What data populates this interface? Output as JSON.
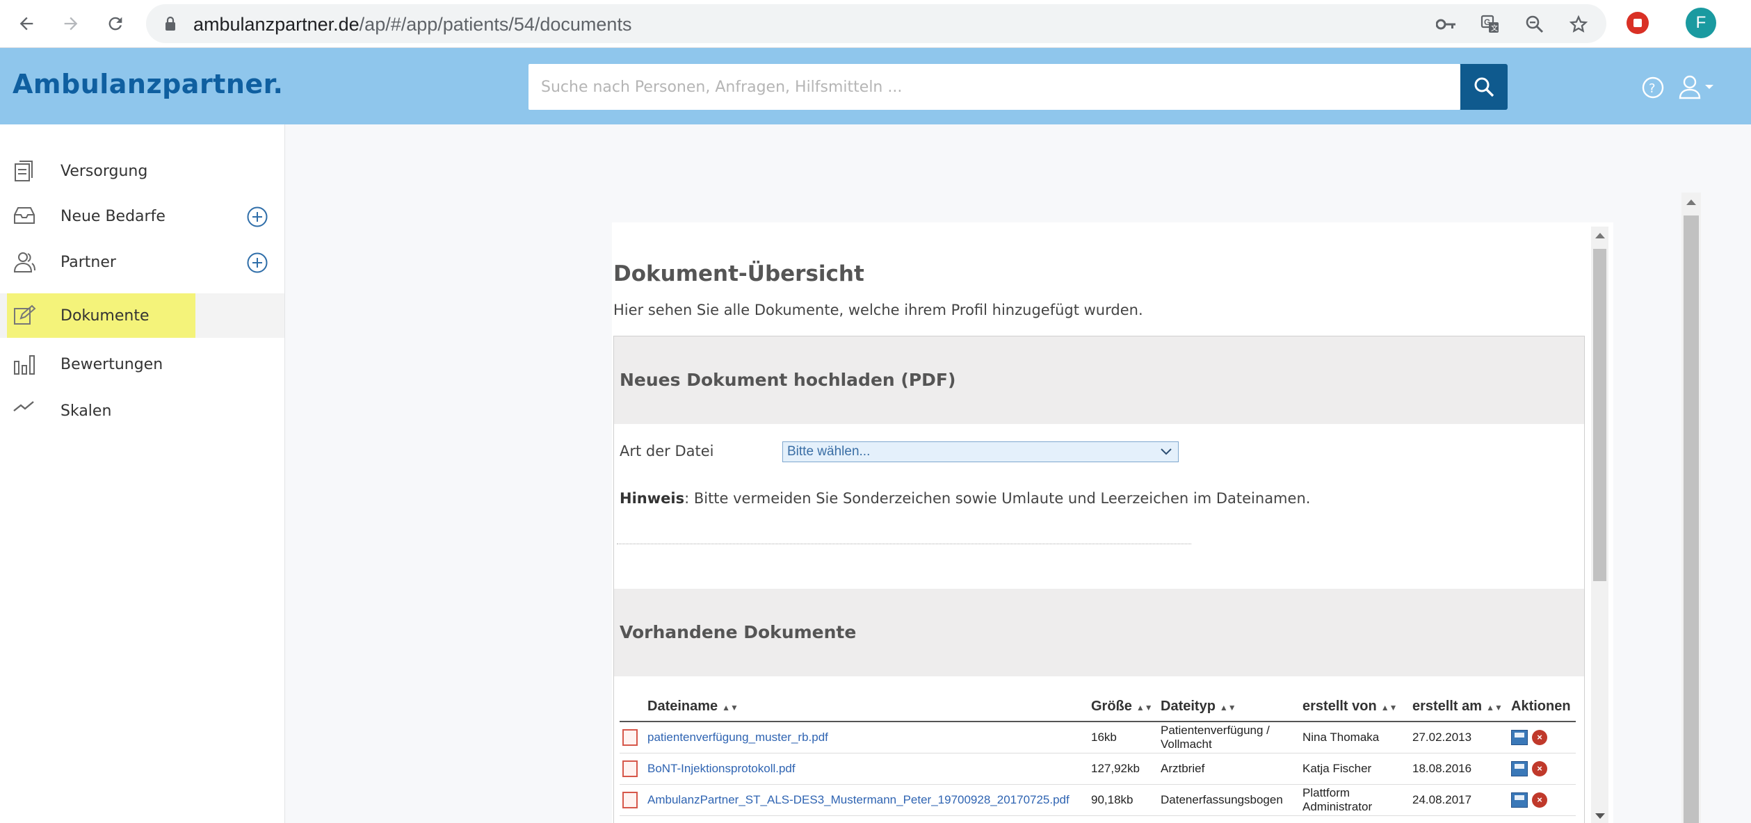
{
  "browser": {
    "url_host": "ambulanzpartner.de",
    "url_path": "/ap/#/app/patients/54/documents",
    "profile_initial": "F",
    "icons": [
      "back-icon",
      "forward-icon",
      "reload-icon",
      "lock-icon",
      "key-icon",
      "translate-icon",
      "zoom-icon",
      "star-icon",
      "extension-stop-icon"
    ]
  },
  "header": {
    "logo": "Ambulanzpartner.",
    "search_placeholder": "Suche nach Personen, Anfragen, Hilfsmitteln ...",
    "colors": {
      "header_bg": "#8fc6ec",
      "logo": "#0f5fa0",
      "search_button": "#0f5a8e"
    }
  },
  "sidebar": {
    "items": [
      {
        "label": "Versorgung",
        "icon": "clipboard-icon"
      },
      {
        "label": "Neue Bedarfe",
        "icon": "inbox-icon",
        "has_add": true
      },
      {
        "label": "Partner",
        "icon": "people-icon",
        "has_add": true
      },
      {
        "label": "Dokumente",
        "icon": "edit-icon",
        "active": true
      },
      {
        "label": "Bewertungen",
        "icon": "bar-chart-icon"
      },
      {
        "label": "Skalen",
        "icon": "trend-icon"
      }
    ],
    "highlight_color": "#f4f37a"
  },
  "main": {
    "title": "Dokument-Übersicht",
    "subtitle": "Hier sehen Sie alle Dokumente, welche ihrem Profil hinzugefügt wurden.",
    "upload": {
      "heading": "Neues Dokument hochladen (PDF)",
      "file_type_label": "Art der Datei",
      "file_type_value": "Bitte wählen...",
      "hint_bold": "Hinweis",
      "hint_text": ": Bitte vermeiden Sie Sonderzeichen sowie Umlaute und Leerzeichen im Dateinamen."
    },
    "existing": {
      "heading": "Vorhandene Dokumente",
      "columns": [
        "Dateiname",
        "Größe",
        "Dateityp",
        "erstellt von",
        "erstellt am",
        "Aktionen"
      ],
      "rows": [
        {
          "filename": "patientenverfügung_muster_rb.pdf",
          "size": "16kb",
          "type": "Patientenverfügung / Vollmacht",
          "created_by": "Nina Thomaka",
          "created_at": "27.02.2013"
        },
        {
          "filename": "BoNT-Injektionsprotokoll.pdf",
          "size": "127,92kb",
          "type": "Arztbrief",
          "created_by": "Katja Fischer",
          "created_at": "18.08.2016"
        },
        {
          "filename": "AmbulanzPartner_ST_ALS-DES3_Mustermann_Peter_19700928_20170725.pdf",
          "size": "90,18kb",
          "type": "Datenerfassungsbogen",
          "created_by": "Plattform Administrator",
          "created_at": "24.08.2017"
        }
      ]
    }
  }
}
